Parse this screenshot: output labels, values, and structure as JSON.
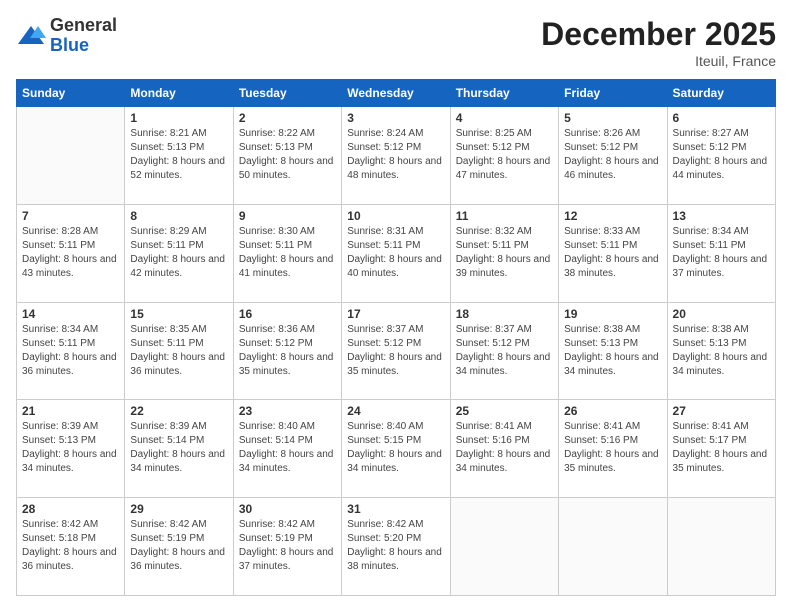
{
  "header": {
    "logo_line1": "General",
    "logo_line2": "Blue",
    "month_year": "December 2025",
    "location": "Iteuil, France"
  },
  "weekdays": [
    "Sunday",
    "Monday",
    "Tuesday",
    "Wednesday",
    "Thursday",
    "Friday",
    "Saturday"
  ],
  "weeks": [
    [
      {
        "day": "",
        "sunrise": "",
        "sunset": "",
        "daylight": ""
      },
      {
        "day": "1",
        "sunrise": "Sunrise: 8:21 AM",
        "sunset": "Sunset: 5:13 PM",
        "daylight": "Daylight: 8 hours and 52 minutes."
      },
      {
        "day": "2",
        "sunrise": "Sunrise: 8:22 AM",
        "sunset": "Sunset: 5:13 PM",
        "daylight": "Daylight: 8 hours and 50 minutes."
      },
      {
        "day": "3",
        "sunrise": "Sunrise: 8:24 AM",
        "sunset": "Sunset: 5:12 PM",
        "daylight": "Daylight: 8 hours and 48 minutes."
      },
      {
        "day": "4",
        "sunrise": "Sunrise: 8:25 AM",
        "sunset": "Sunset: 5:12 PM",
        "daylight": "Daylight: 8 hours and 47 minutes."
      },
      {
        "day": "5",
        "sunrise": "Sunrise: 8:26 AM",
        "sunset": "Sunset: 5:12 PM",
        "daylight": "Daylight: 8 hours and 46 minutes."
      },
      {
        "day": "6",
        "sunrise": "Sunrise: 8:27 AM",
        "sunset": "Sunset: 5:12 PM",
        "daylight": "Daylight: 8 hours and 44 minutes."
      }
    ],
    [
      {
        "day": "7",
        "sunrise": "Sunrise: 8:28 AM",
        "sunset": "Sunset: 5:11 PM",
        "daylight": "Daylight: 8 hours and 43 minutes."
      },
      {
        "day": "8",
        "sunrise": "Sunrise: 8:29 AM",
        "sunset": "Sunset: 5:11 PM",
        "daylight": "Daylight: 8 hours and 42 minutes."
      },
      {
        "day": "9",
        "sunrise": "Sunrise: 8:30 AM",
        "sunset": "Sunset: 5:11 PM",
        "daylight": "Daylight: 8 hours and 41 minutes."
      },
      {
        "day": "10",
        "sunrise": "Sunrise: 8:31 AM",
        "sunset": "Sunset: 5:11 PM",
        "daylight": "Daylight: 8 hours and 40 minutes."
      },
      {
        "day": "11",
        "sunrise": "Sunrise: 8:32 AM",
        "sunset": "Sunset: 5:11 PM",
        "daylight": "Daylight: 8 hours and 39 minutes."
      },
      {
        "day": "12",
        "sunrise": "Sunrise: 8:33 AM",
        "sunset": "Sunset: 5:11 PM",
        "daylight": "Daylight: 8 hours and 38 minutes."
      },
      {
        "day": "13",
        "sunrise": "Sunrise: 8:34 AM",
        "sunset": "Sunset: 5:11 PM",
        "daylight": "Daylight: 8 hours and 37 minutes."
      }
    ],
    [
      {
        "day": "14",
        "sunrise": "Sunrise: 8:34 AM",
        "sunset": "Sunset: 5:11 PM",
        "daylight": "Daylight: 8 hours and 36 minutes."
      },
      {
        "day": "15",
        "sunrise": "Sunrise: 8:35 AM",
        "sunset": "Sunset: 5:11 PM",
        "daylight": "Daylight: 8 hours and 36 minutes."
      },
      {
        "day": "16",
        "sunrise": "Sunrise: 8:36 AM",
        "sunset": "Sunset: 5:12 PM",
        "daylight": "Daylight: 8 hours and 35 minutes."
      },
      {
        "day": "17",
        "sunrise": "Sunrise: 8:37 AM",
        "sunset": "Sunset: 5:12 PM",
        "daylight": "Daylight: 8 hours and 35 minutes."
      },
      {
        "day": "18",
        "sunrise": "Sunrise: 8:37 AM",
        "sunset": "Sunset: 5:12 PM",
        "daylight": "Daylight: 8 hours and 34 minutes."
      },
      {
        "day": "19",
        "sunrise": "Sunrise: 8:38 AM",
        "sunset": "Sunset: 5:13 PM",
        "daylight": "Daylight: 8 hours and 34 minutes."
      },
      {
        "day": "20",
        "sunrise": "Sunrise: 8:38 AM",
        "sunset": "Sunset: 5:13 PM",
        "daylight": "Daylight: 8 hours and 34 minutes."
      }
    ],
    [
      {
        "day": "21",
        "sunrise": "Sunrise: 8:39 AM",
        "sunset": "Sunset: 5:13 PM",
        "daylight": "Daylight: 8 hours and 34 minutes."
      },
      {
        "day": "22",
        "sunrise": "Sunrise: 8:39 AM",
        "sunset": "Sunset: 5:14 PM",
        "daylight": "Daylight: 8 hours and 34 minutes."
      },
      {
        "day": "23",
        "sunrise": "Sunrise: 8:40 AM",
        "sunset": "Sunset: 5:14 PM",
        "daylight": "Daylight: 8 hours and 34 minutes."
      },
      {
        "day": "24",
        "sunrise": "Sunrise: 8:40 AM",
        "sunset": "Sunset: 5:15 PM",
        "daylight": "Daylight: 8 hours and 34 minutes."
      },
      {
        "day": "25",
        "sunrise": "Sunrise: 8:41 AM",
        "sunset": "Sunset: 5:16 PM",
        "daylight": "Daylight: 8 hours and 34 minutes."
      },
      {
        "day": "26",
        "sunrise": "Sunrise: 8:41 AM",
        "sunset": "Sunset: 5:16 PM",
        "daylight": "Daylight: 8 hours and 35 minutes."
      },
      {
        "day": "27",
        "sunrise": "Sunrise: 8:41 AM",
        "sunset": "Sunset: 5:17 PM",
        "daylight": "Daylight: 8 hours and 35 minutes."
      }
    ],
    [
      {
        "day": "28",
        "sunrise": "Sunrise: 8:42 AM",
        "sunset": "Sunset: 5:18 PM",
        "daylight": "Daylight: 8 hours and 36 minutes."
      },
      {
        "day": "29",
        "sunrise": "Sunrise: 8:42 AM",
        "sunset": "Sunset: 5:19 PM",
        "daylight": "Daylight: 8 hours and 36 minutes."
      },
      {
        "day": "30",
        "sunrise": "Sunrise: 8:42 AM",
        "sunset": "Sunset: 5:19 PM",
        "daylight": "Daylight: 8 hours and 37 minutes."
      },
      {
        "day": "31",
        "sunrise": "Sunrise: 8:42 AM",
        "sunset": "Sunset: 5:20 PM",
        "daylight": "Daylight: 8 hours and 38 minutes."
      },
      {
        "day": "",
        "sunrise": "",
        "sunset": "",
        "daylight": ""
      },
      {
        "day": "",
        "sunrise": "",
        "sunset": "",
        "daylight": ""
      },
      {
        "day": "",
        "sunrise": "",
        "sunset": "",
        "daylight": ""
      }
    ]
  ]
}
